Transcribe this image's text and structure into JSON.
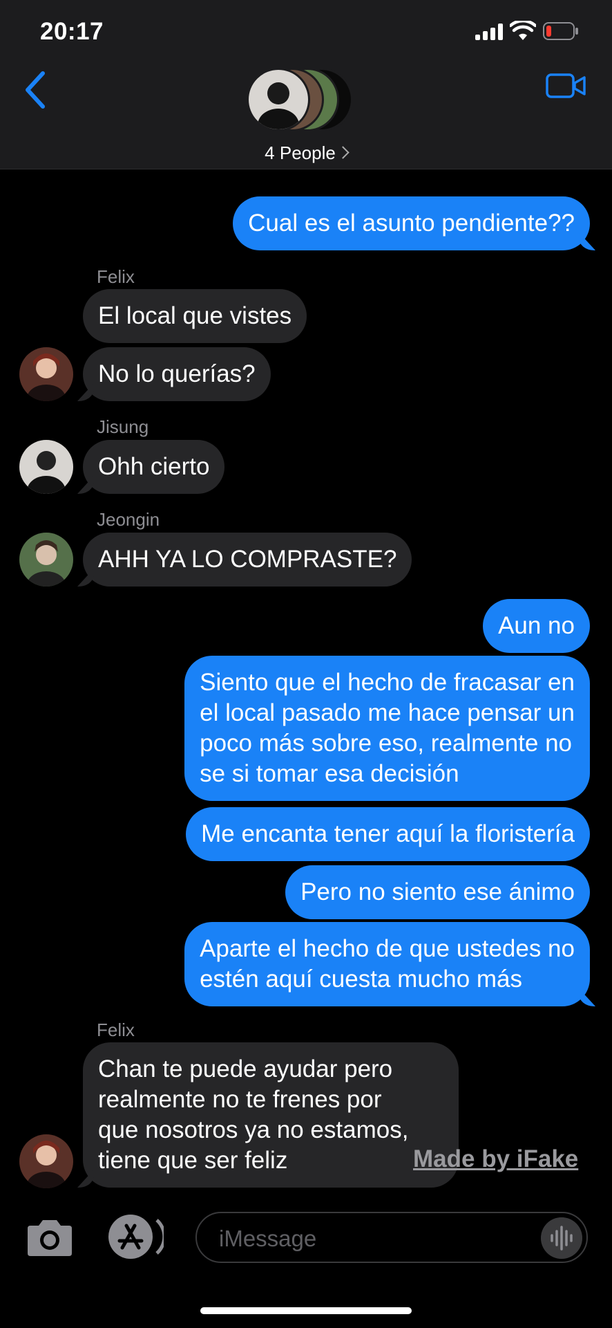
{
  "status_bar": {
    "time": "20:17"
  },
  "header": {
    "people_label": "4 People"
  },
  "messages": [
    {
      "direction": "out",
      "text": "Cual es el asunto pendiente??"
    },
    {
      "direction": "in",
      "sender": "Felix",
      "text": "El local que vistes"
    },
    {
      "direction": "in",
      "text": "No lo querías?"
    },
    {
      "direction": "in",
      "sender": "Jisung",
      "text": "Ohh cierto"
    },
    {
      "direction": "in",
      "sender": "Jeongin",
      "text": "AHH YA LO COMPRASTE?"
    },
    {
      "direction": "out",
      "text": "Aun no"
    },
    {
      "direction": "out",
      "text": "Siento que el hecho de fracasar en\nel local pasado me hace pensar un\npoco más sobre eso, realmente no\nse si tomar esa decisión"
    },
    {
      "direction": "out",
      "text": "Me encanta tener aquí la floristería"
    },
    {
      "direction": "out",
      "text": "Pero no siento ese ánimo"
    },
    {
      "direction": "out",
      "text": "Aparte el hecho de que ustedes no\nestén aquí cuesta mucho más"
    },
    {
      "direction": "in",
      "sender": "Felix",
      "text": "Chan te puede ayudar pero\nrealmente no te frenes por\nque nosotros ya no estamos,\ntiene que ser feliz"
    }
  ],
  "watermark": "Made by iFake",
  "composer": {
    "placeholder": "iMessage"
  },
  "colors": {
    "outgoing_bubble": "#1a82f7",
    "incoming_bubble": "#262628",
    "accent": "#1a82f7",
    "header_bg": "#1c1c1e",
    "background": "#000000"
  },
  "icons": [
    "back-chevron-icon",
    "video-camera-icon",
    "camera-icon",
    "app-store-icon",
    "audio-waveform-icon",
    "wifi-icon",
    "battery-icon",
    "signal-icon"
  ]
}
